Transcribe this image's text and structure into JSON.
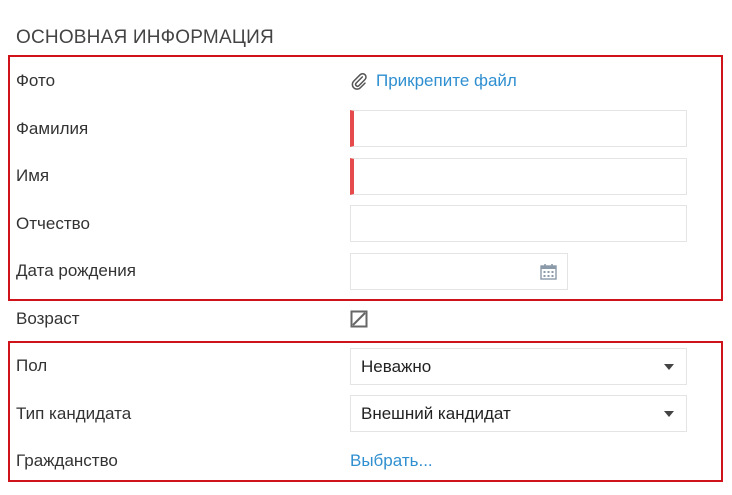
{
  "section": {
    "title": "ОСНОВНАЯ ИНФОРМАЦИЯ"
  },
  "fields": {
    "photo": {
      "label": "Фото",
      "link_text": "Прикрепите файл",
      "icon": "paperclip-icon"
    },
    "last_name": {
      "label": "Фамилия",
      "value": "",
      "required": true
    },
    "first_name": {
      "label": "Имя",
      "value": "",
      "required": true
    },
    "middle_name": {
      "label": "Отчество",
      "value": ""
    },
    "birth_date": {
      "label": "Дата рождения",
      "value": "",
      "icon": "calendar-icon"
    },
    "age": {
      "label": "Возраст",
      "icon": "age-toggle-icon"
    },
    "gender": {
      "label": "Пол",
      "selected": "Неважно"
    },
    "candidate_type": {
      "label": "Тип кандидата",
      "selected": "Внешний кандидат"
    },
    "citizenship": {
      "label": "Гражданство",
      "link_text": "Выбрать..."
    }
  },
  "colors": {
    "highlight_border": "#d0121b",
    "required_marker": "#e64b4b",
    "link": "#2f8fd0"
  }
}
